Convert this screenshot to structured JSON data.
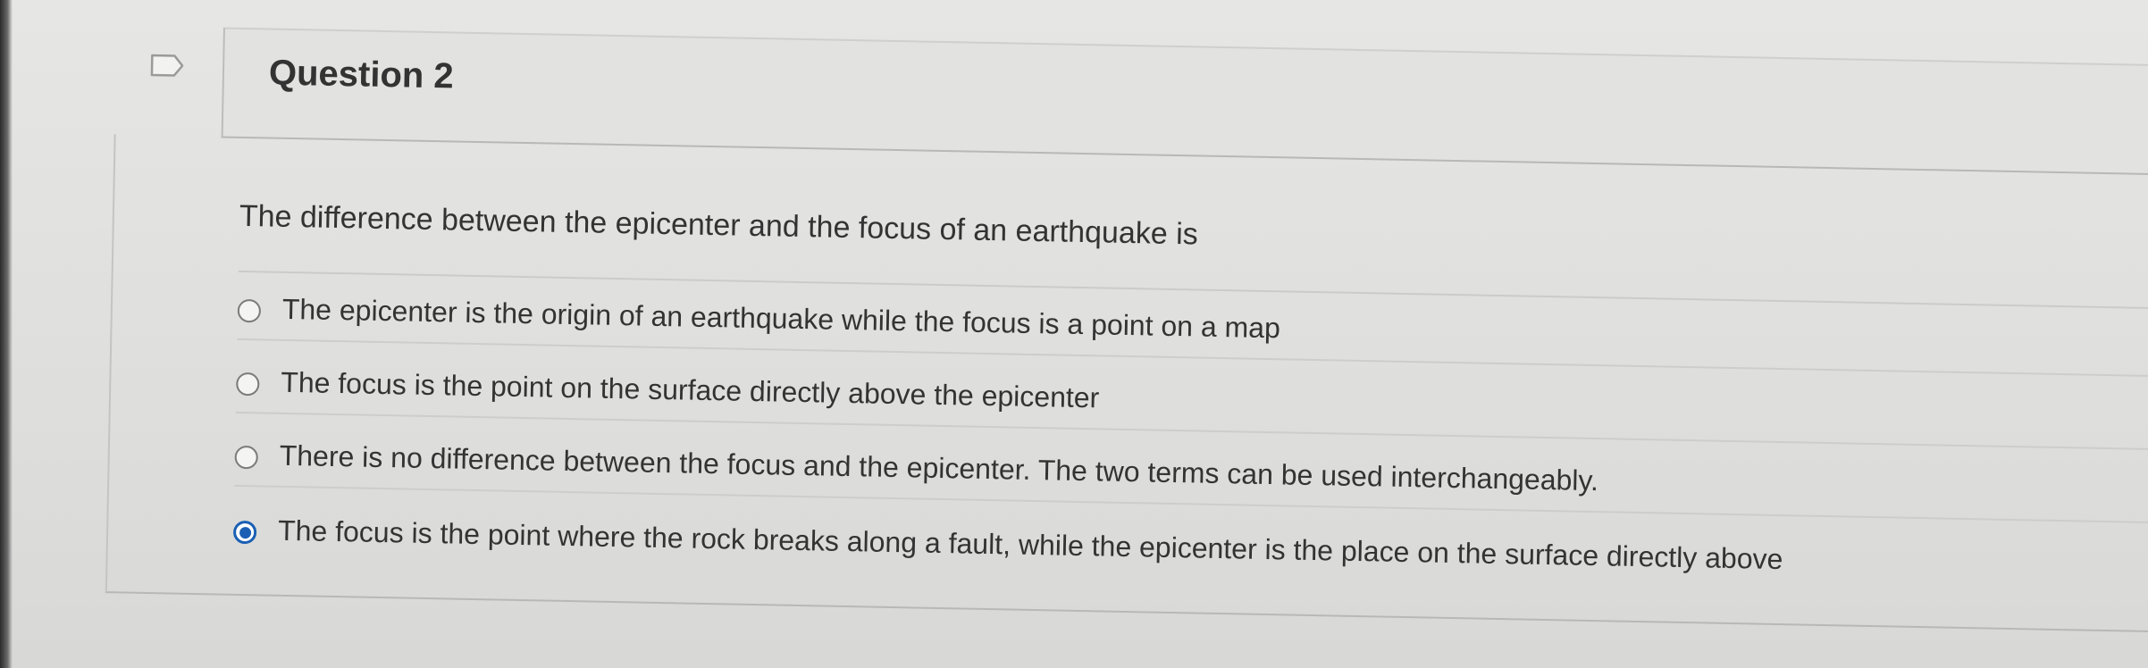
{
  "question": {
    "title": "Question 2",
    "text": "The difference between the epicenter and the focus of an earthquake is",
    "answers": [
      {
        "label": "The epicenter is the origin of an earthquake while the focus is a point on a map",
        "selected": false
      },
      {
        "label": "The focus is the point on the surface directly above the epicenter",
        "selected": false
      },
      {
        "label": "There is no difference between the focus and the epicenter. The two terms can be used interchangeably.",
        "selected": false
      },
      {
        "label": "The focus is the point where the rock breaks along a fault, while the epicenter is the place on the surface directly above",
        "selected": true
      }
    ]
  },
  "colors": {
    "selected_radio": "#1a5fb4",
    "text": "#333333",
    "background": "#e3e3e1"
  },
  "icons": {
    "flag": "flag-question-icon"
  }
}
